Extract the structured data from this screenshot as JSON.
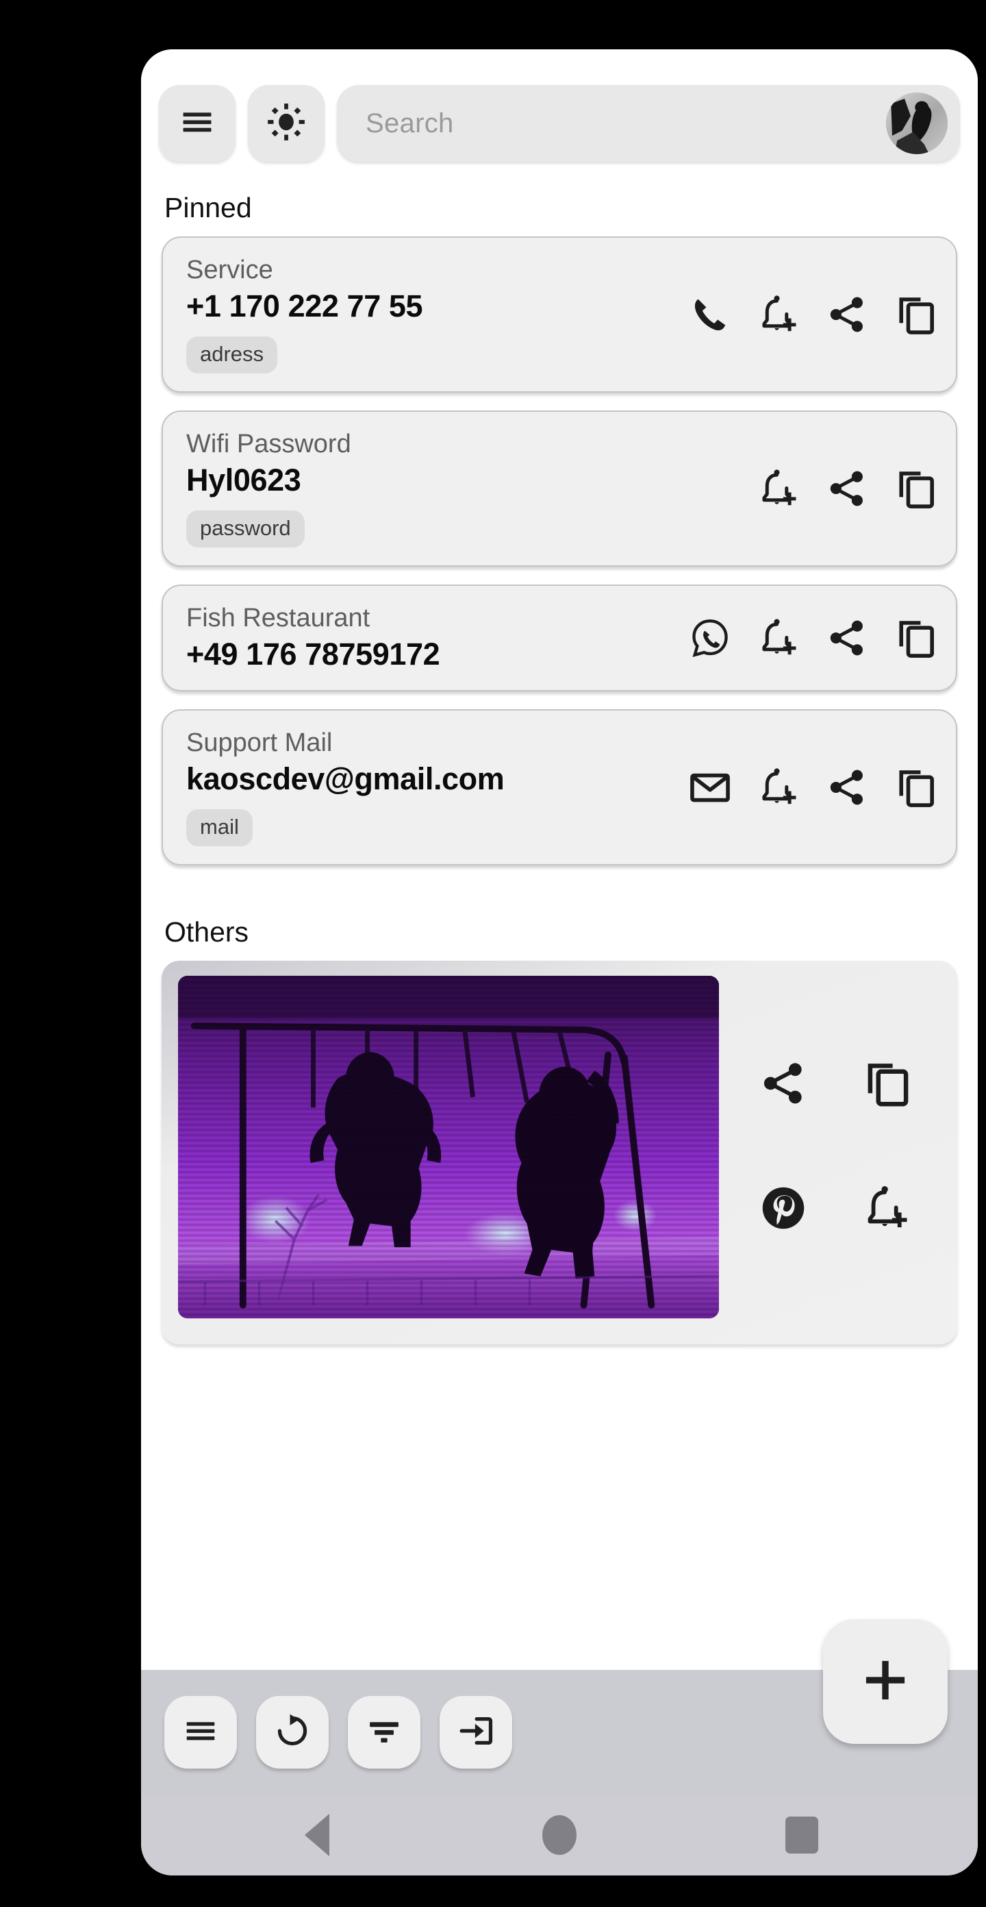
{
  "app": {
    "header": {
      "menu_icon": "hamburger-menu-icon",
      "theme_icon": "brightness-sun-icon",
      "search_placeholder": "Search",
      "avatar_icon": "user-avatar"
    },
    "sections": [
      {
        "id": "pinned",
        "title": "Pinned"
      },
      {
        "id": "others",
        "title": "Others"
      }
    ],
    "pinned_entries": [
      {
        "label": "Service",
        "value": "+1 170 222 77 55",
        "tag": "adress",
        "actions": [
          "phone-icon",
          "bell-plus-icon",
          "share-icon",
          "copy-icon"
        ]
      },
      {
        "label": "Wifi Password",
        "value": "Hyl0623",
        "tag": "password",
        "actions": [
          "bell-plus-icon",
          "share-icon",
          "copy-icon"
        ]
      },
      {
        "label": "Fish Restaurant",
        "value": "+49 176 78759172",
        "tag": "",
        "actions": [
          "whatsapp-icon",
          "bell-plus-icon",
          "share-icon",
          "copy-icon"
        ]
      },
      {
        "label": "Support Mail",
        "value": "kaoscdev@gmail.com",
        "tag": "mail",
        "actions": [
          "mail-icon",
          "bell-plus-icon",
          "share-icon",
          "copy-icon"
        ]
      }
    ],
    "other_entries": [
      {
        "type": "image",
        "description": "two children silhouetted on swings, purple tinted photo",
        "actions": [
          "share-icon",
          "copy-icon",
          "pinterest-icon",
          "bell-plus-icon"
        ]
      }
    ],
    "toolbar": {
      "buttons": [
        "list-menu-icon",
        "refresh-icon",
        "filter-sort-icon",
        "import-login-icon"
      ],
      "fab": "plus-icon"
    },
    "navbar": {
      "back": "back-triangle-icon",
      "home": "home-circle-icon",
      "recents": "recents-square-icon"
    },
    "colors": {
      "card_bg": "#f0f0f0",
      "card_border": "#c4c4c4",
      "chip_bg": "#dcdcdc",
      "toolbar_bg": "#cbcbd2",
      "label_gray": "#5e5e5e",
      "photo_accent": "#8a2be2"
    }
  }
}
